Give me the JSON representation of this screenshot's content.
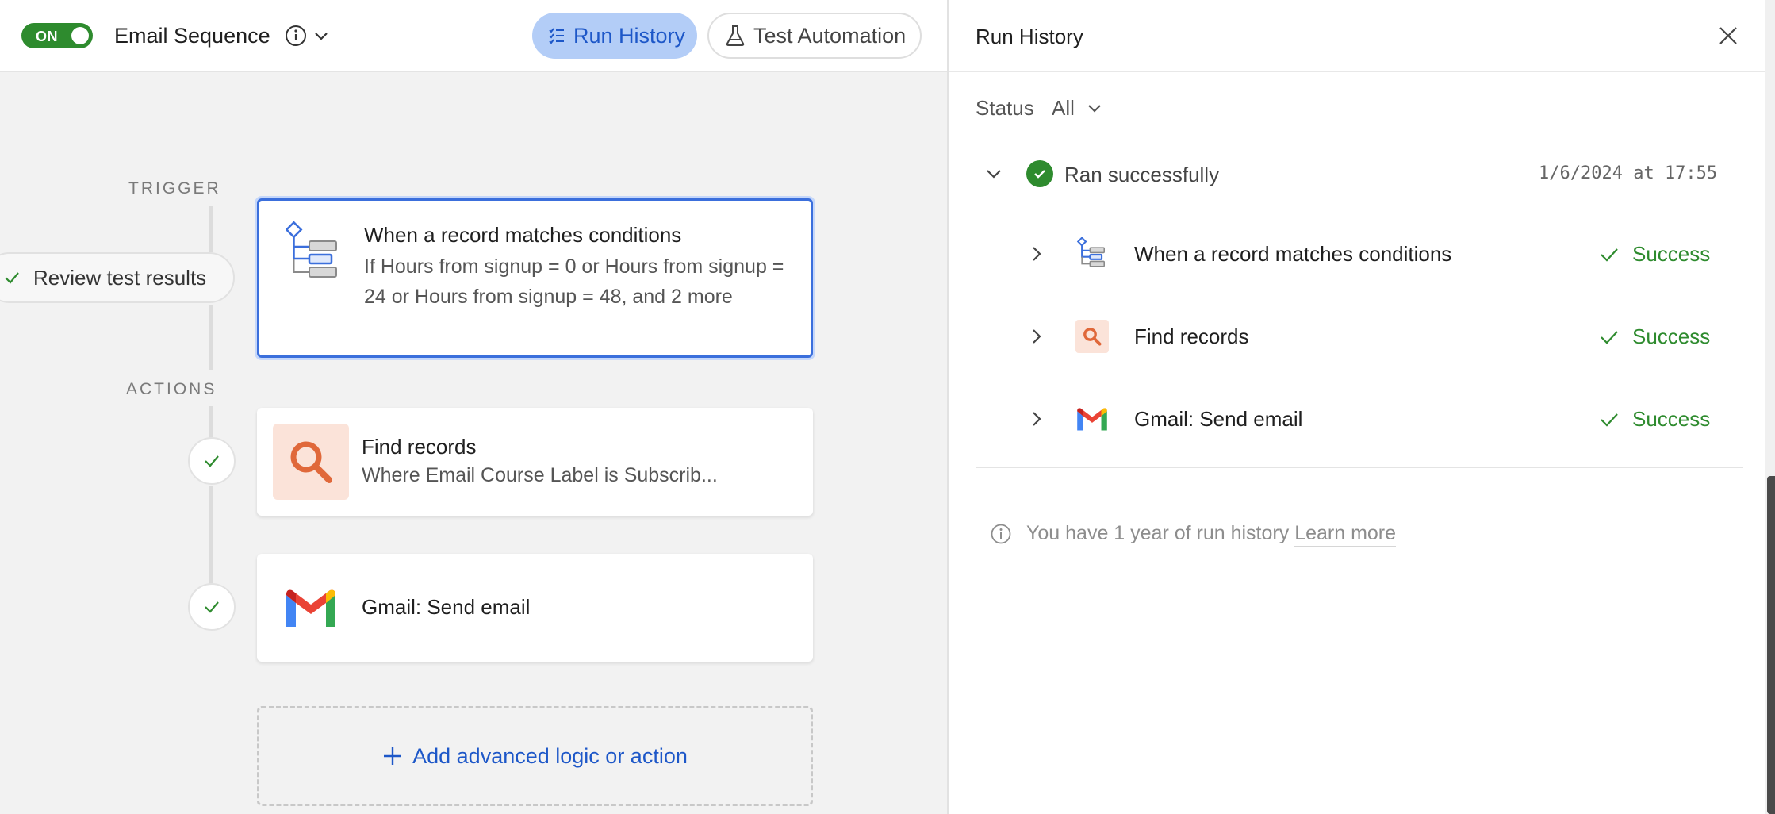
{
  "topbar": {
    "toggle_label": "ON",
    "sequence_title": "Email Sequence",
    "run_history_label": "Run History",
    "test_automation_label": "Test Automation"
  },
  "canvas": {
    "trigger_label": "TRIGGER",
    "actions_label": "ACTIONS",
    "review_label": "Review test results",
    "trigger_card": {
      "title": "When a record matches conditions",
      "description": "If Hours from signup = 0 or Hours from signup = 24 or Hours from signup = 48, and 2 more"
    },
    "actions": [
      {
        "title": "Find records",
        "description": "Where Email Course Label is Subscrib..."
      },
      {
        "title": "Gmail: Send email",
        "description": ""
      }
    ],
    "add_label": "Add advanced logic or action"
  },
  "panel": {
    "title": "Run History",
    "status_label": "Status",
    "status_value": "All",
    "run": {
      "label": "Ran successfully",
      "timestamp": "1/6/2024 at 17:55",
      "steps": [
        {
          "name": "When a record matches conditions",
          "status": "Success",
          "icon": "trigger-tree-icon"
        },
        {
          "name": "Find records",
          "status": "Success",
          "icon": "magnifier-icon"
        },
        {
          "name": "Gmail: Send email",
          "status": "Success",
          "icon": "gmail-icon"
        }
      ]
    },
    "history_note": "You have 1 year of run history",
    "learn_more": "Learn more"
  },
  "colors": {
    "accent_blue": "#1d57c8",
    "run_button_bg": "#b3cdf7",
    "success_green": "#2e8b2e",
    "trigger_border": "#3b6fdc",
    "find_icon_bg": "#fbe3d9",
    "find_icon_fg": "#e0683a"
  }
}
